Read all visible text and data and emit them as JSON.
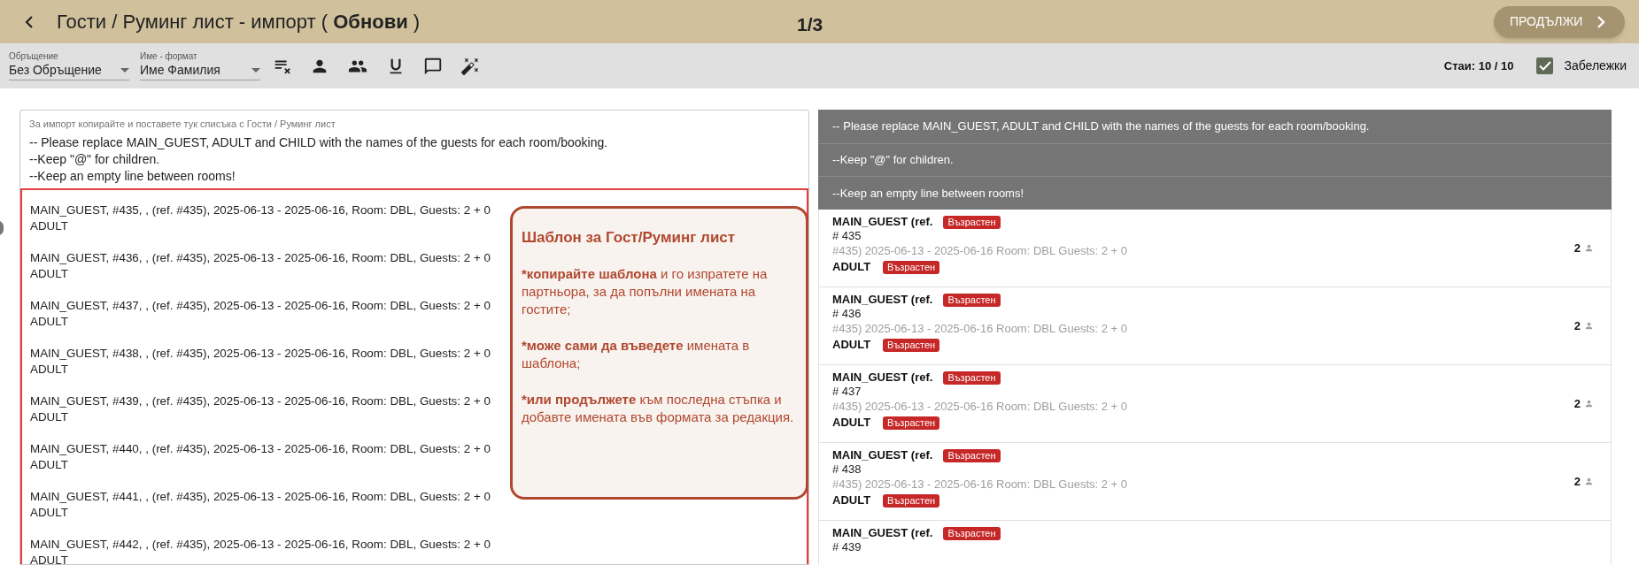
{
  "header": {
    "title": "Гости / Руминг лист - импорт ( **Обнови** )",
    "step": "1/3",
    "continue_button": "ПРОДЪЛЖИ"
  },
  "toolbar": {
    "selects": [
      {
        "label": "Обръщение",
        "value": "Без Обръщение"
      },
      {
        "label": "Име - формат",
        "value": "Име Фамилия"
      }
    ],
    "rooms": "Стаи: 10 / 10",
    "notes": {
      "label": "Забележки",
      "checked": true
    }
  },
  "import_box": {
    "label": "За импорт копирайте и поставете тук списъка с Гости / Руминг лист",
    "instructions": [
      "-- Please replace MAIN_GUEST, ADULT and CHILD with the names of the guests for each room/booking.",
      "--Keep \"@\" for children.",
      "--Keep an empty line between rooms!"
    ],
    "entries": [
      {
        "line": "MAIN_GUEST, #435, , (ref. #435), 2025-06-13 - 2025-06-16, Room: DBL, Guests: 2 + 0",
        "guest": "ADULT"
      },
      {
        "line": "MAIN_GUEST, #436, , (ref. #435), 2025-06-13 - 2025-06-16, Room: DBL, Guests: 2 + 0",
        "guest": "ADULT"
      },
      {
        "line": "MAIN_GUEST, #437, , (ref. #435), 2025-06-13 - 2025-06-16, Room: DBL, Guests: 2 + 0",
        "guest": "ADULT"
      },
      {
        "line": "MAIN_GUEST, #438, , (ref. #435), 2025-06-13 - 2025-06-16, Room: DBL, Guests: 2 + 0",
        "guest": "ADULT"
      },
      {
        "line": "MAIN_GUEST, #439, , (ref. #435), 2025-06-13 - 2025-06-16, Room: DBL, Guests: 2 + 0",
        "guest": "ADULT"
      },
      {
        "line": "MAIN_GUEST, #440, , (ref. #435), 2025-06-13 - 2025-06-16, Room: DBL, Guests: 2 + 0",
        "guest": "ADULT"
      },
      {
        "line": "MAIN_GUEST, #441, , (ref. #435), 2025-06-13 - 2025-06-16, Room: DBL, Guests: 2 + 0",
        "guest": "ADULT"
      },
      {
        "line": "MAIN_GUEST, #442, , (ref. #435), 2025-06-13 - 2025-06-16, Room: DBL, Guests: 2 + 0",
        "guest": "ADULT"
      }
    ]
  },
  "tooltip": {
    "title": "Шаблон за Гост/Руминг лист",
    "paragraphs": [
      "***копирайте шаблона** и го изпратете на партньора, за да попълни имената на гостите;",
      "***може сами да въведете** имената в шаблона;",
      "***или продължете** към последна стъпка и добавте имената във формата за редакция."
    ]
  },
  "preview": {
    "instructions": [
      "-- Please replace MAIN_GUEST, ADULT and CHILD with the names of the guests for each room/booking.",
      "--Keep \"@\" for children.",
      "--Keep an empty line between rooms!"
    ],
    "rooms": [
      {
        "name": "MAIN_GUEST (ref.",
        "badge": "Възрастен",
        "ref": "# 435",
        "details": "#435) 2025-06-13 - 2025-06-16 Room: DBL Guests: 2 + 0",
        "guest": "ADULT",
        "guest_badge": "Възрастен",
        "count": "2"
      },
      {
        "name": "MAIN_GUEST (ref.",
        "badge": "Възрастен",
        "ref": "# 436",
        "details": "#435) 2025-06-13 - 2025-06-16 Room: DBL Guests: 2 + 0",
        "guest": "ADULT",
        "guest_badge": "Възрастен",
        "count": "2"
      },
      {
        "name": "MAIN_GUEST (ref.",
        "badge": "Възрастен",
        "ref": "# 437",
        "details": "#435) 2025-06-13 - 2025-06-16 Room: DBL Guests: 2 + 0",
        "guest": "ADULT",
        "guest_badge": "Възрастен",
        "count": "2"
      },
      {
        "name": "MAIN_GUEST (ref.",
        "badge": "Възрастен",
        "ref": "# 438",
        "details": "#435) 2025-06-13 - 2025-06-16 Room: DBL Guests: 2 + 0",
        "guest": "ADULT",
        "guest_badge": "Възрастен",
        "count": "2"
      },
      {
        "name": "MAIN_GUEST (ref.",
        "badge": "Възрастен",
        "ref": "# 439"
      }
    ]
  }
}
